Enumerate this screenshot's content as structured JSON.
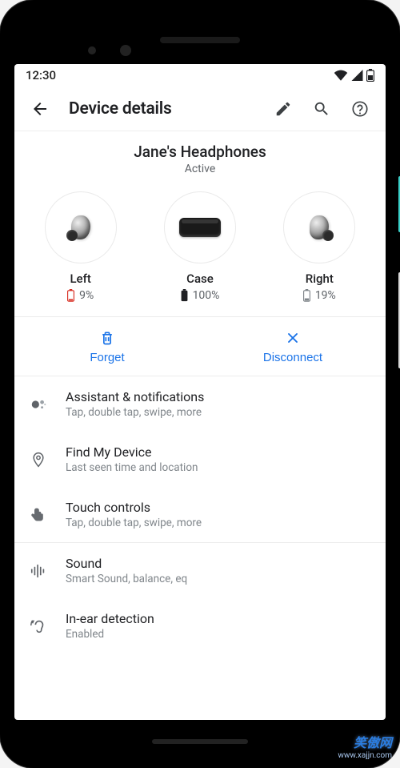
{
  "status_bar": {
    "time": "12:30"
  },
  "header": {
    "title": "Device details"
  },
  "device": {
    "name": "Jane's Headphones",
    "status": "Active"
  },
  "battery": {
    "left": {
      "label": "Left",
      "value": "9%",
      "color": "#d93025"
    },
    "case": {
      "label": "Case",
      "value": "100%",
      "color": "#202124"
    },
    "right": {
      "label": "Right",
      "value": "19%",
      "color": "#80868b"
    }
  },
  "actions": {
    "forget": "Forget",
    "disconnect": "Disconnect"
  },
  "list": {
    "assistant": {
      "primary": "Assistant & notifications",
      "secondary": "Tap, double tap, swipe, more"
    },
    "find": {
      "primary": "Find My Device",
      "secondary": "Last seen time and location"
    },
    "touch": {
      "primary": "Touch controls",
      "secondary": "Tap, double tap, swipe, more"
    },
    "sound": {
      "primary": "Sound",
      "secondary": "Smart Sound, balance, eq"
    },
    "inear": {
      "primary": "In-ear detection",
      "secondary": "Enabled"
    }
  },
  "watermark": {
    "brand": "笑傲网",
    "url": "www.xajjn.com"
  }
}
